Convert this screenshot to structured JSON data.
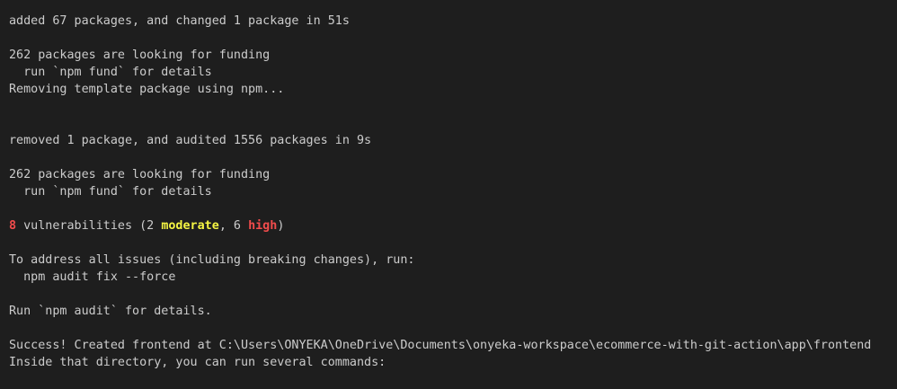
{
  "terminal": {
    "colors": {
      "background": "#1e1e1e",
      "foreground": "#cccccc",
      "error_red": "#f14c4c",
      "warning_yellow": "#f5f543"
    },
    "lines": {
      "l1": "added 67 packages, and changed 1 package in 51s",
      "l3": "262 packages are looking for funding",
      "l4": "  run `npm fund` for details",
      "l5": "Removing template package using npm...",
      "l8": "removed 1 package, and audited 1556 packages in 9s",
      "l10": "262 packages are looking for funding",
      "l11": "  run `npm fund` for details",
      "vuln": {
        "count": "8",
        "text1": " vulnerabilities (2 ",
        "moderate": "moderate",
        "text2": ", 6 ",
        "high": "high",
        "text3": ")"
      },
      "l15": "To address all issues (including breaking changes), run:",
      "l16": "  npm audit fix --force",
      "l18": "Run `npm audit` for details.",
      "l20": "Success! Created frontend at C:\\Users\\ONYEKA\\OneDrive\\Documents\\onyeka-workspace\\ecommerce-with-git-action\\app\\frontend",
      "l21": "Inside that directory, you can run several commands:"
    }
  }
}
